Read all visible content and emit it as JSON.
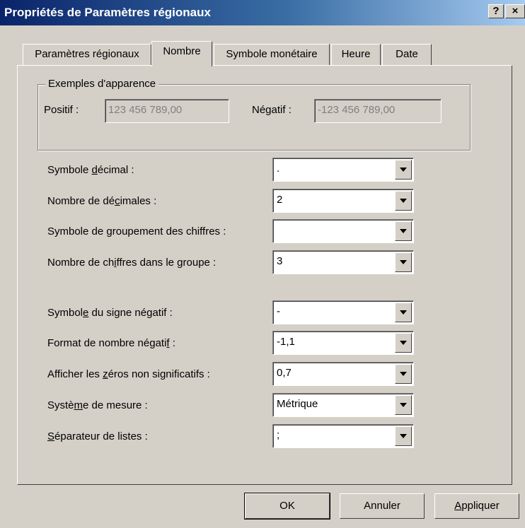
{
  "window": {
    "title": "Propriétés de Paramètres régionaux",
    "help_button": "?",
    "close_button": "×"
  },
  "tabs": [
    {
      "label": "Paramètres régionaux",
      "active": false
    },
    {
      "label": "Nombre",
      "active": true
    },
    {
      "label": "Symbole monétaire",
      "active": false
    },
    {
      "label": "Heure",
      "active": false
    },
    {
      "label": "Date",
      "active": false
    }
  ],
  "examples": {
    "group_label": "Exemples d'apparence",
    "positive_label": "Positif :",
    "positive_value": "123 456 789,00",
    "negative_label": "Négatif :",
    "negative_value": "-123 456 789,00"
  },
  "settings": [
    {
      "pre": "Symbole ",
      "ul": "d",
      "post": "écimal :",
      "value": "."
    },
    {
      "pre": "Nombre de dé",
      "ul": "c",
      "post": "imales :",
      "value": "2"
    },
    {
      "pre": "Symbole de ",
      "ul": "g",
      "post": "roupement des chiffres :",
      "value": ""
    },
    {
      "pre": "Nombre de ch",
      "ul": "i",
      "post": "ffres dans le groupe :",
      "value": "3"
    },
    {
      "pre": "Symbol",
      "ul": "e",
      "post": " du signe négatif :",
      "value": "-"
    },
    {
      "pre": "Format de nombre négati",
      "ul": "f",
      "post": " :",
      "value": "-1,1"
    },
    {
      "pre": "Afficher les ",
      "ul": "z",
      "post": "éros non significatifs :",
      "value": "0,7"
    },
    {
      "pre": "Systè",
      "ul": "m",
      "post": "e de mesure :",
      "value": "Métrique"
    },
    {
      "pre": "",
      "ul": "S",
      "post": "éparateur de listes :",
      "value": ";"
    }
  ],
  "buttons": {
    "ok": "OK",
    "cancel": "Annuler",
    "apply_ul": "A",
    "apply_rest": "ppliquer"
  },
  "colors": {
    "face": "#d4d0c8",
    "title_start": "#0a246a",
    "title_end": "#a6caf0",
    "disabled_text": "#808080"
  }
}
